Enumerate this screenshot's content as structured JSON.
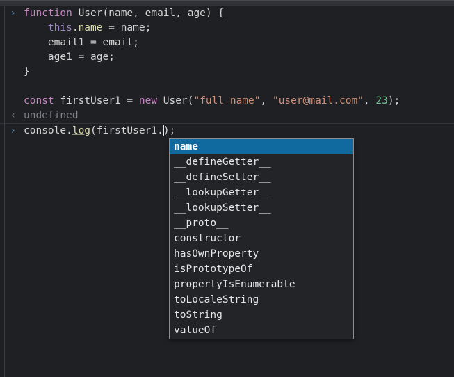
{
  "panel": {
    "name": "devtools-console",
    "background_color": "#1f2023",
    "toolbar_color": "#2f3135"
  },
  "console": {
    "entries": [
      {
        "type": "input",
        "marker": "›",
        "lines": [
          [
            {
              "text": "function ",
              "cls": "kw"
            },
            {
              "text": "User",
              "cls": "ctor"
            },
            {
              "text": "(name, email, age) {",
              "cls": "punc"
            }
          ],
          [
            {
              "text": "    ",
              "cls": "punc"
            },
            {
              "text": "this",
              "cls": "this-kw"
            },
            {
              "text": ".",
              "cls": "punc"
            },
            {
              "text": "name",
              "cls": "prop"
            },
            {
              "text": " = name;",
              "cls": "punc"
            }
          ],
          [
            {
              "text": "    email1 = email;",
              "cls": "punc"
            }
          ],
          [
            {
              "text": "    age1 = age;",
              "cls": "punc"
            }
          ],
          [
            {
              "text": "}",
              "cls": "punc"
            }
          ],
          [
            {
              "text": "",
              "cls": "punc"
            }
          ],
          [
            {
              "text": "const",
              "cls": "kw"
            },
            {
              "text": " firstUser1 = ",
              "cls": "punc"
            },
            {
              "text": "new",
              "cls": "kw"
            },
            {
              "text": " User(",
              "cls": "punc"
            },
            {
              "text": "\"full name\"",
              "cls": "str"
            },
            {
              "text": ", ",
              "cls": "punc"
            },
            {
              "text": "\"user@mail.com\"",
              "cls": "str"
            },
            {
              "text": ", ",
              "cls": "punc"
            },
            {
              "text": "23",
              "cls": "num"
            },
            {
              "text": ");",
              "cls": "punc"
            }
          ]
        ]
      },
      {
        "type": "output",
        "marker": "‹",
        "text": "undefined"
      },
      {
        "type": "input-active",
        "marker": "›",
        "lines": [
          [
            {
              "text": "console",
              "cls": "ident"
            },
            {
              "text": ".",
              "cls": "punc"
            },
            {
              "text": "log",
              "cls": "fn"
            },
            {
              "text": "(firstUser1.",
              "cls": "punc"
            },
            {
              "text": "__CARET__",
              "cls": "caret"
            },
            {
              "text": ");",
              "cls": "punc"
            }
          ]
        ]
      }
    ]
  },
  "autocomplete": {
    "name": "property-autocomplete-popup",
    "selected_index": 0,
    "selection_color": "#10699f",
    "items": [
      "name",
      "__defineGetter__",
      "__defineSetter__",
      "__lookupGetter__",
      "__lookupSetter__",
      "__proto__",
      "constructor",
      "hasOwnProperty",
      "isPrototypeOf",
      "propertyIsEnumerable",
      "toLocaleString",
      "toString",
      "valueOf"
    ]
  }
}
